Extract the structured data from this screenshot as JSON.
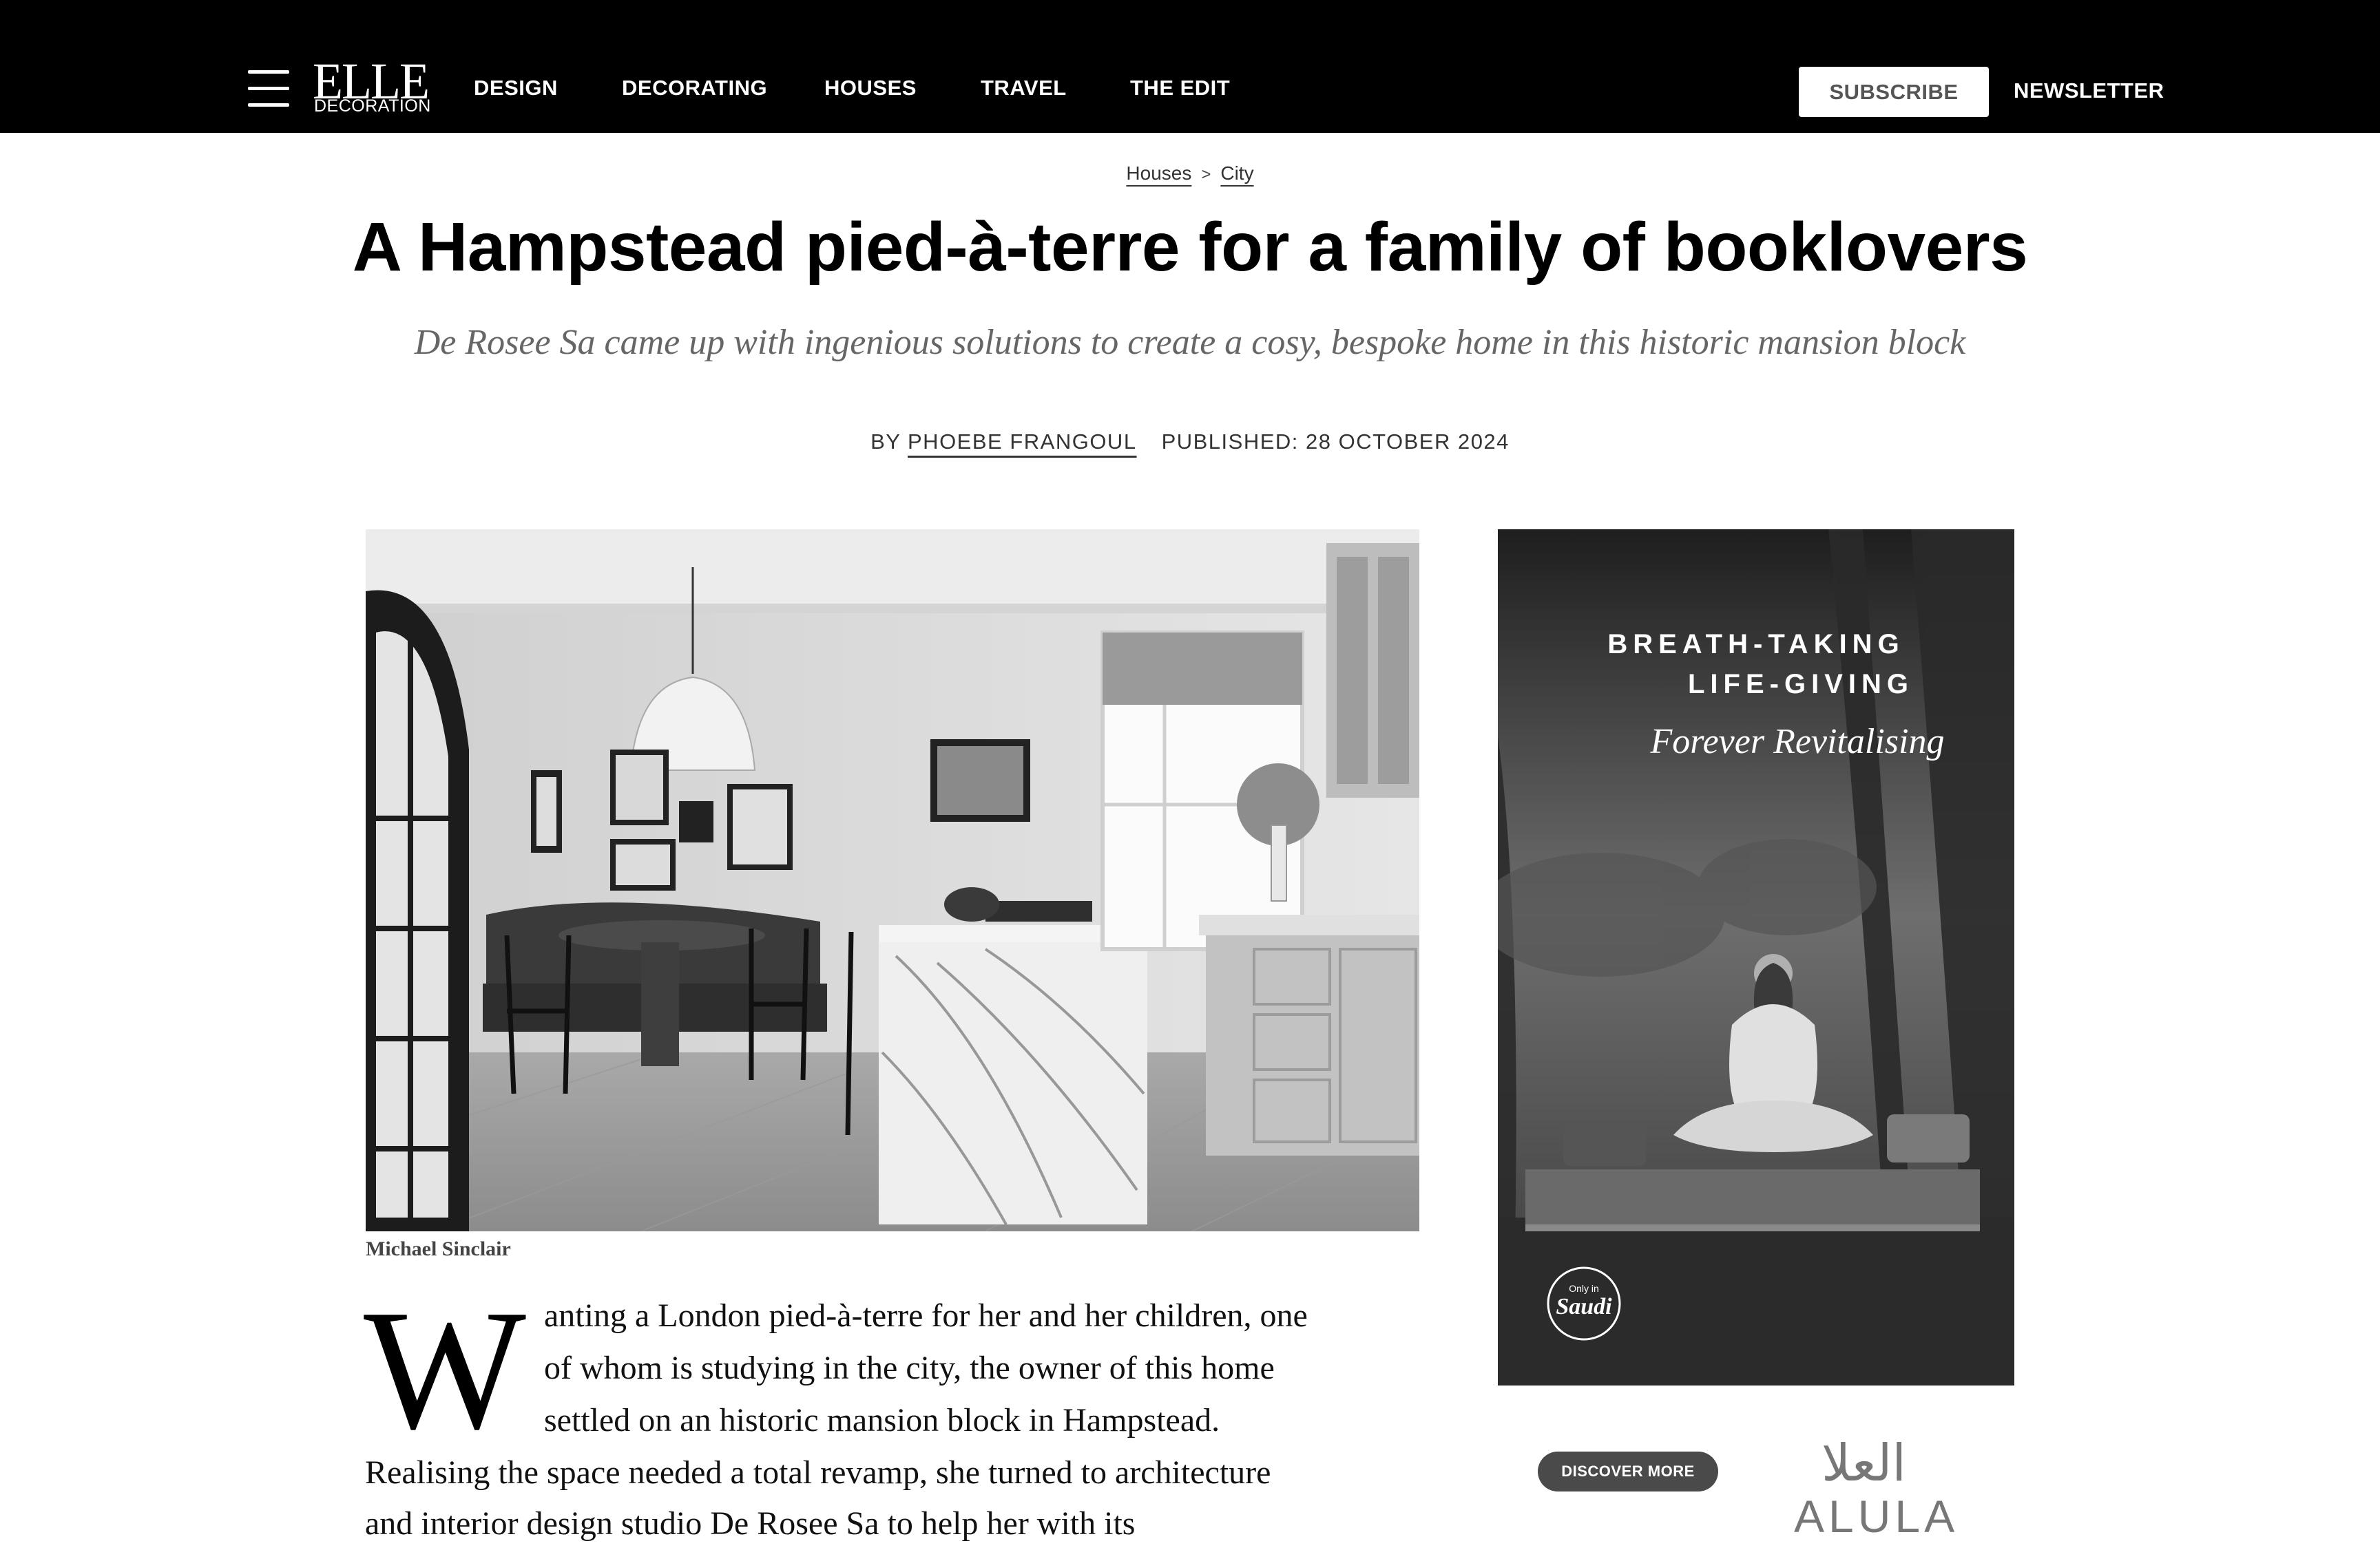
{
  "header": {
    "logo_main": "ELLE",
    "logo_sub": "DECORATION",
    "nav": [
      "DESIGN",
      "DECORATING",
      "HOUSES",
      "TRAVEL",
      "THE EDIT"
    ],
    "subscribe_label": "SUBSCRIBE",
    "newsletter_label": "NEWSLETTER"
  },
  "breadcrumb": {
    "items": [
      "Houses",
      "City"
    ],
    "separator": ">"
  },
  "article": {
    "title": "A Hampstead pied-à-terre for a family of booklovers",
    "dek": "De Rosee Sa came up with ingenious solutions to create a cosy, bespoke home in this historic mansion block",
    "by_label": "BY",
    "author": "PHOEBE FRANGOUL",
    "published": "PUBLISHED: 28 OCTOBER 2024",
    "image_credit": "Michael Sinclair",
    "dropcap": "W",
    "lines": [
      "anting a London pied-à-terre for her and her children, one",
      "of whom is studying in the city, the owner of this home",
      "settled on an historic mansion block in Hampstead.",
      "Realising the space needed a total revamp, she turned to architecture",
      "and interior design studio De Rosee Sa to help her with its"
    ]
  },
  "ad": {
    "headline_1": "BREATH-TAKING",
    "headline_2": "LIFE-GIVING",
    "script": "Forever Revitalising",
    "badge_top": "Only in",
    "badge_main": "Saudi",
    "cta": "DISCOVER MORE",
    "brand_ar": "العلا",
    "brand_en": "ALULA"
  },
  "colors": {
    "header_bg": "#000000",
    "text": "#111111",
    "dek": "#666666"
  }
}
